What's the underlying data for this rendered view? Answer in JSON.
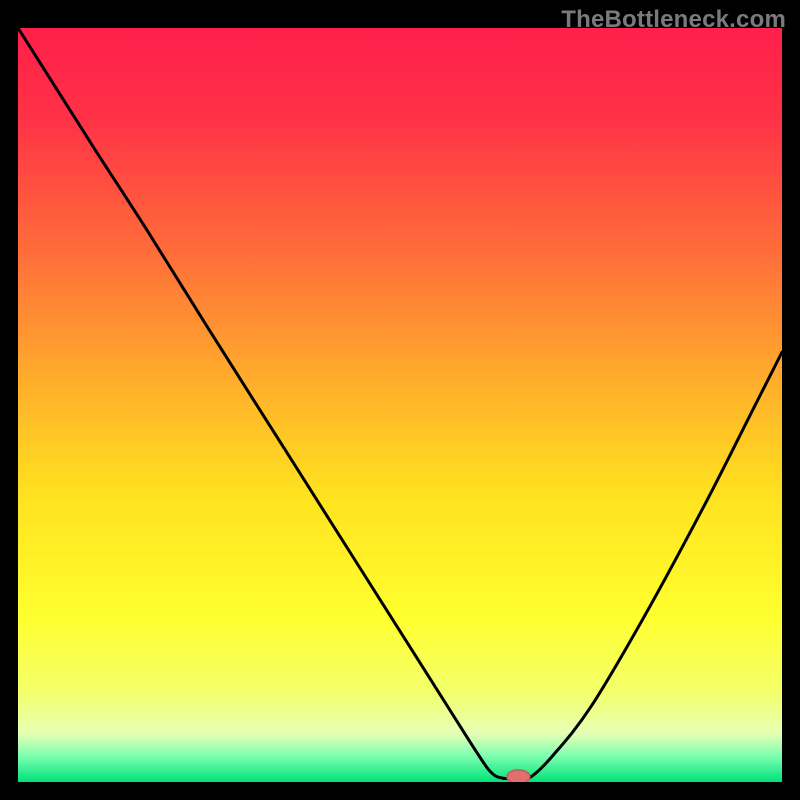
{
  "watermark": "TheBottleneck.com",
  "chart_data": {
    "type": "line",
    "title": "",
    "xlabel": "",
    "ylabel": "",
    "xlim": [
      0,
      100
    ],
    "ylim": [
      0,
      100
    ],
    "grid": false,
    "legend": false,
    "background_gradient_stops": [
      {
        "offset": 0.0,
        "color": "#ff1f4b"
      },
      {
        "offset": 0.12,
        "color": "#ff3246"
      },
      {
        "offset": 0.3,
        "color": "#ff6e3a"
      },
      {
        "offset": 0.48,
        "color": "#ffb22a"
      },
      {
        "offset": 0.62,
        "color": "#ffe21f"
      },
      {
        "offset": 0.78,
        "color": "#ffff2e"
      },
      {
        "offset": 0.88,
        "color": "#f3ff6a"
      },
      {
        "offset": 0.935,
        "color": "#e7ffb5"
      },
      {
        "offset": 0.965,
        "color": "#7fffb0"
      },
      {
        "offset": 1.0,
        "color": "#00e27a"
      }
    ],
    "series": [
      {
        "name": "curve",
        "color": "#000000",
        "stroke_width": 3,
        "x": [
          0,
          5,
          10,
          17,
          25,
          35,
          45,
          55,
          60,
          62,
          63.5,
          65,
          67,
          70,
          75,
          82,
          90,
          96,
          100
        ],
        "y": [
          100,
          92,
          84,
          73,
          60,
          44,
          28,
          12,
          4,
          1.2,
          0.5,
          0.5,
          0.6,
          3.5,
          10,
          22,
          37,
          49,
          57
        ]
      }
    ],
    "marker": {
      "name": "highlight",
      "x": 65.5,
      "y": 0.7,
      "rx": 1.5,
      "ry": 0.9,
      "fill": "#e07070",
      "stroke": "#c85a5a"
    }
  }
}
